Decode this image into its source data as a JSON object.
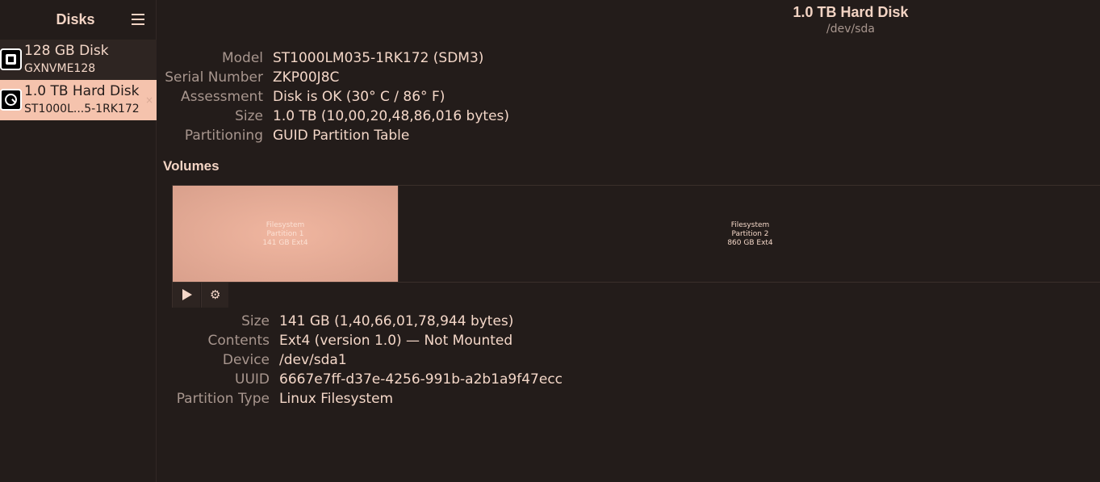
{
  "sidebar": {
    "title": "Disks",
    "disks": [
      {
        "name": "128 GB Disk",
        "subtitle": "GXNVME128",
        "icon": "ssd-chip-icon"
      },
      {
        "name": "1.0 TB Hard Disk",
        "subtitle": "ST1000L...5-1RK172",
        "icon": "hard-disk-icon",
        "selected": true
      }
    ]
  },
  "disk": {
    "title": "1.0 TB Hard Disk",
    "device": "/dev/sda",
    "properties": [
      {
        "label": "Model",
        "value": "ST1000LM035-1RK172 (SDM3)"
      },
      {
        "label": "Serial Number",
        "value": "ZKP00J8C"
      },
      {
        "label": "Assessment",
        "value": "Disk is OK (30° C / 86° F)"
      },
      {
        "label": "Size",
        "value": "1.0 TB (10,00,20,48,86,016 bytes)"
      },
      {
        "label": "Partitioning",
        "value": "GUID Partition Table"
      }
    ]
  },
  "volumes": {
    "heading": "Volumes",
    "partitions": [
      {
        "type": "Filesystem",
        "name": "Partition 1",
        "size": "141 GB Ext4",
        "selected": true
      },
      {
        "type": "Filesystem",
        "name": "Partition 2",
        "size": "860 GB Ext4"
      }
    ],
    "toolbar": [
      "play-icon",
      "gears-icon"
    ],
    "selected_properties": [
      {
        "label": "Size",
        "value": "141 GB (1,40,66,01,78,944 bytes)"
      },
      {
        "label": "Contents",
        "value": "Ext4 (version 1.0) — Not Mounted"
      },
      {
        "label": "Device",
        "value": "/dev/sda1"
      },
      {
        "label": "UUID",
        "value": "6667e7ff-d37e-4256-991b-a2b1a9f47ecc"
      },
      {
        "label": "Partition Type",
        "value": "Linux Filesystem"
      }
    ]
  },
  "colors": {
    "background": "#231c1a",
    "accent": "#f5c3ad",
    "partition_selected": "#e5ab96",
    "label": "#a8968e",
    "text": "#f4d7c8"
  }
}
